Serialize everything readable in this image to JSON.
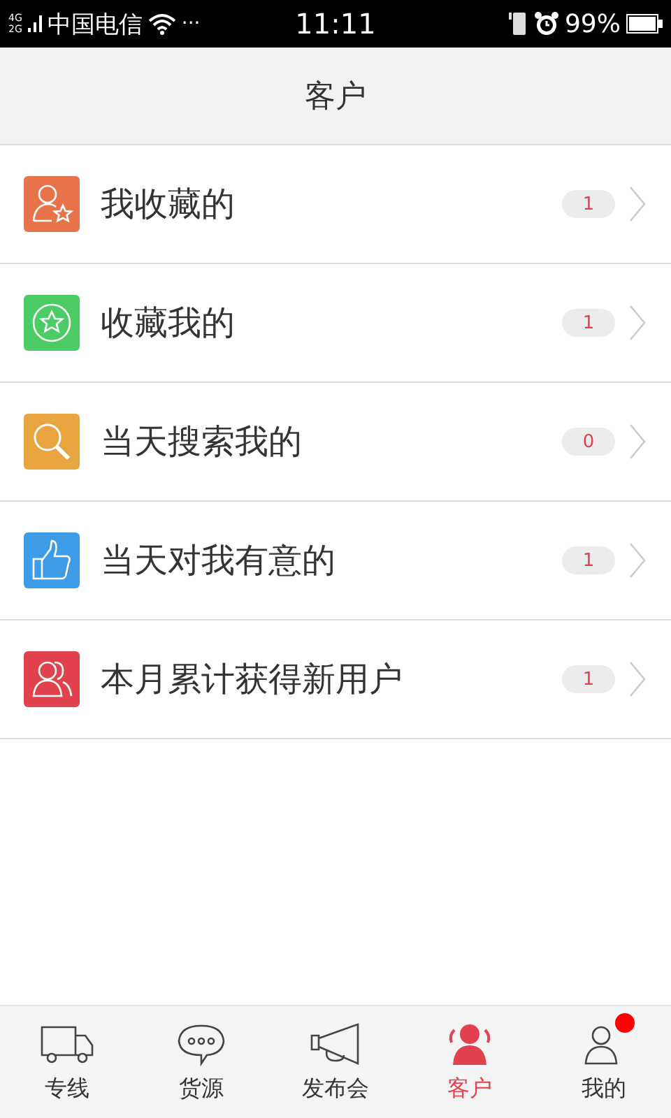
{
  "status_bar": {
    "network": [
      "4G",
      "2G"
    ],
    "carrier": "中国电信",
    "more": "···",
    "time": "11:11",
    "battery": "99%"
  },
  "header": {
    "title": "客户"
  },
  "items": [
    {
      "label": "我收藏的",
      "count": "1",
      "kind": "person-star",
      "color": "#e8734a"
    },
    {
      "label": "收藏我的",
      "count": "1",
      "kind": "star-circle",
      "color": "#4bcc64"
    },
    {
      "label": "当天搜索我的",
      "count": "0",
      "kind": "search",
      "color": "#e8a43e"
    },
    {
      "label": "当天对我有意的",
      "count": "1",
      "kind": "thumb",
      "color": "#3e9be6"
    },
    {
      "label": "本月累计获得新用户",
      "count": "1",
      "kind": "users",
      "color": "#e2424d"
    }
  ],
  "tabs": [
    {
      "label": "专线",
      "kind": "truck",
      "selected": false,
      "badge": false
    },
    {
      "label": "货源",
      "kind": "chat",
      "selected": false,
      "badge": false
    },
    {
      "label": "发布会",
      "kind": "megaphone",
      "selected": false,
      "badge": false
    },
    {
      "label": "客户",
      "kind": "users",
      "selected": true,
      "badge": false
    },
    {
      "label": "我的",
      "kind": "person",
      "selected": false,
      "badge": true
    }
  ]
}
